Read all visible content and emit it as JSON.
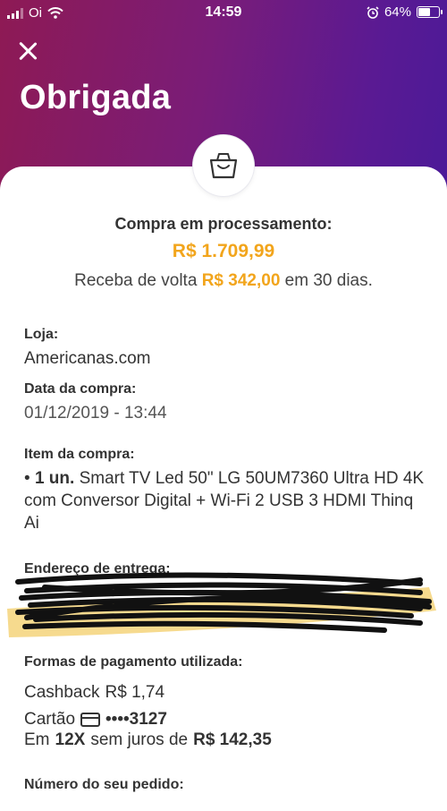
{
  "status_bar": {
    "carrier": "Oi",
    "time": "14:59",
    "battery": "64%",
    "battery_level": 0.64
  },
  "header": {
    "title": "Obrigada"
  },
  "summary": {
    "label": "Compra em processamento:",
    "amount": "R$ 1.709,99",
    "cashback_prefix": "Receba de volta",
    "cashback_amount": "R$ 342,00",
    "cashback_suffix": "em 30 dias."
  },
  "details": {
    "store_label": "Loja:",
    "store_value": "Americanas.com",
    "date_label": "Data da compra:",
    "date_value": "01/12/2019 - 13:44",
    "item_label": "Item da compra:",
    "item_qty": "1 un.",
    "item_name": "Smart TV Led 50\" LG 50UM7360 Ultra HD 4K com Conversor Digital + Wi-Fi 2 USB 3 HDMI Thinq Ai",
    "address_label": "Endereço de entrega:"
  },
  "payment": {
    "label": "Formas de pagamento utilizada:",
    "cashback_label": "Cashback",
    "cashback_value": "R$ 1,74",
    "card_label": "Cartão",
    "card_number": "••••3127",
    "installments_prefix": "Em",
    "installments_count": "12X",
    "installments_middle": "sem juros de",
    "installments_value": "R$ 142,35"
  },
  "order": {
    "label": "Número do seu pedido:"
  },
  "colors": {
    "accent": "#f2a51c",
    "gradient_start": "#8e1a54",
    "gradient_end": "#4b1a98"
  },
  "icons": {
    "close": "close-icon",
    "bag": "shopping-bag-icon",
    "card": "credit-card-icon"
  }
}
